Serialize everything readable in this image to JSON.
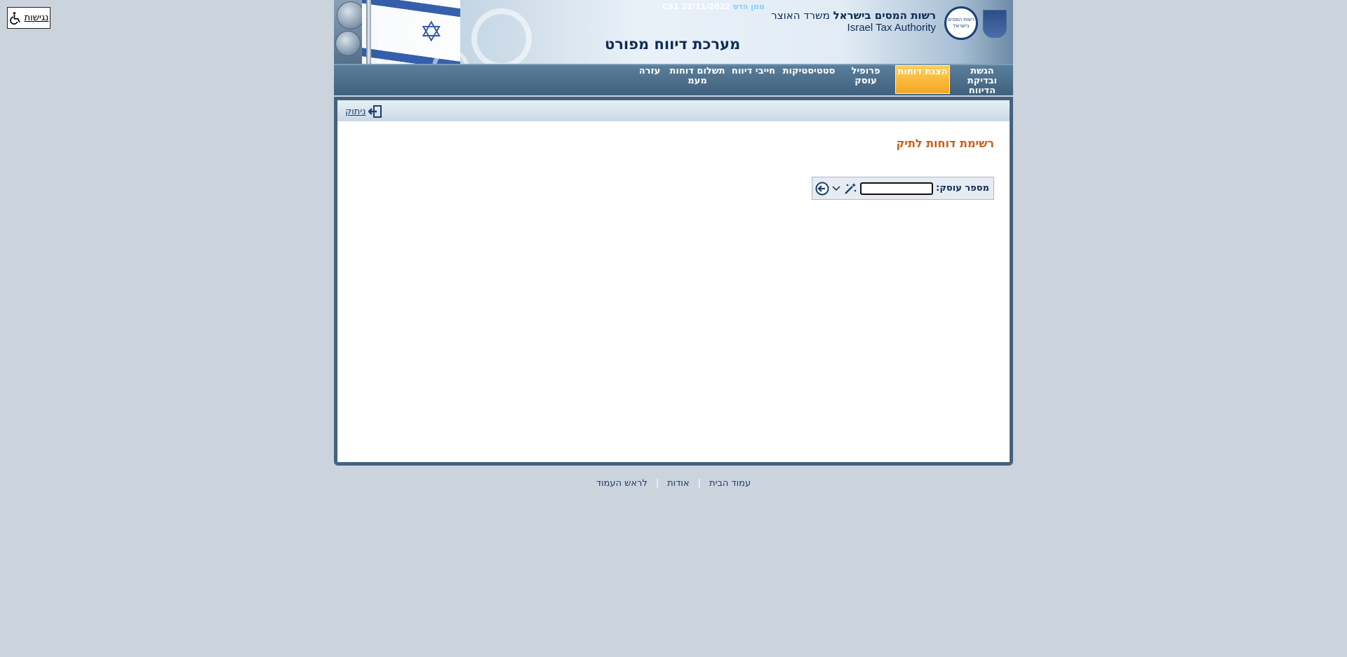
{
  "accessibility": {
    "label": "נגישות",
    "icon": "wheelchair-icon"
  },
  "header": {
    "build_prefix": "ממן הדס",
    "build_link": "ממן הדס",
    "build_info": "CS1 22/11/2022",
    "authority_bold": "רשות המסים בישראל",
    "authority_ministry": "משרד האוצר",
    "authority_en": "Israel Tax Authority",
    "logo_text": "רשות המסים בישראל",
    "system_title": "מערכת דיווח מפורט"
  },
  "nav": {
    "items": [
      {
        "label": "הגשת ובדיקת הדיווח",
        "active": false
      },
      {
        "label": "הצגת דוחות",
        "active": true
      },
      {
        "label": "פרופיל עוסק",
        "active": false
      },
      {
        "label": "סטטיסטיקות",
        "active": false
      },
      {
        "label": "חייבי דיווח",
        "active": false
      },
      {
        "label": "תשלום דוחות מעמ",
        "active": false
      },
      {
        "label": "עזרה",
        "active": false
      }
    ]
  },
  "toolbar": {
    "disconnect_label": "ניתוק"
  },
  "main": {
    "heading": "רשימת דוחות לתיק",
    "search": {
      "label": "מספר עוסק:",
      "value": "",
      "placeholder": ""
    }
  },
  "footer": {
    "links": [
      "עמוד הבית",
      "אודות",
      "לראש העמוד"
    ]
  },
  "colors": {
    "background": "#cbd3dd",
    "nav": "#3f617e",
    "active_tab": "#f5a722",
    "heading": "#c6601a"
  }
}
